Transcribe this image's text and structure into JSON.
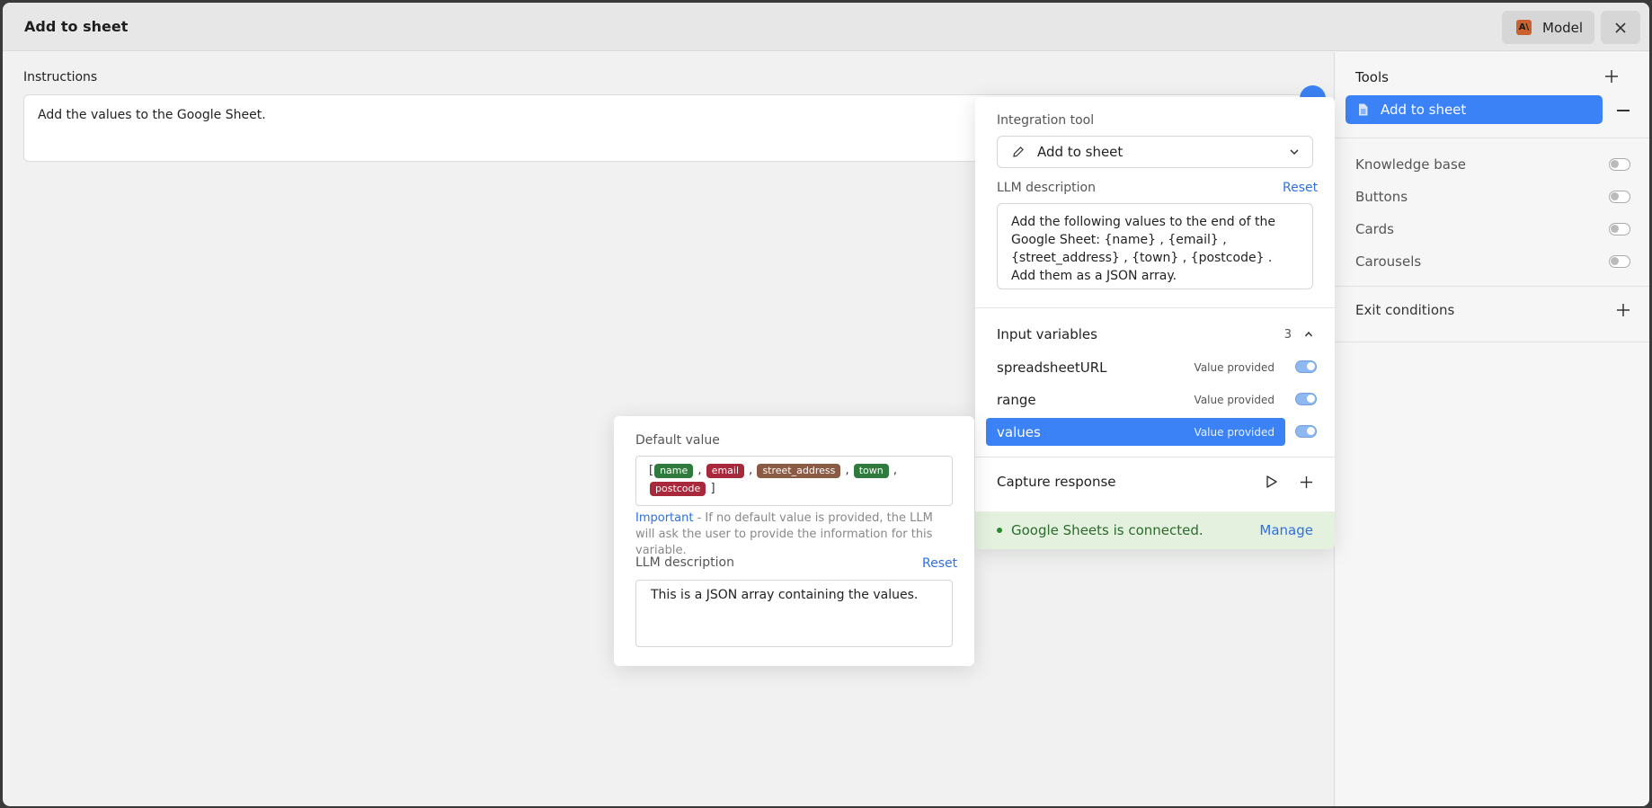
{
  "window": {
    "title": "Add to sheet",
    "model_label": "Model",
    "model_icon": "anthropic-icon"
  },
  "instructions": {
    "label": "Instructions",
    "text": "Add the values to the Google Sheet."
  },
  "sidebar": {
    "tools_header": "Tools",
    "active_tool": "Add to sheet",
    "toggles": [
      {
        "label": "Knowledge base",
        "on": false
      },
      {
        "label": "Buttons",
        "on": false
      },
      {
        "label": "Cards",
        "on": false
      },
      {
        "label": "Carousels",
        "on": false
      }
    ],
    "exit_conditions": "Exit conditions"
  },
  "tool_panel": {
    "integration_label": "Integration tool",
    "integration_value": "Add to sheet",
    "llm_label": "LLM description",
    "reset": "Reset",
    "llm_text": "Add the following values to the end of the Google Sheet: {name} , {email} , {street_address} , {town} , {postcode} . Add them as a JSON array.",
    "input_vars_label": "Input variables",
    "input_vars_count": "3",
    "vars": [
      {
        "name": "spreadsheetURL",
        "status": "Value provided",
        "on": true
      },
      {
        "name": "range",
        "status": "Value provided",
        "on": true
      },
      {
        "name": "values",
        "status": "Value provided",
        "on": true,
        "selected": true
      }
    ],
    "capture_label": "Capture response",
    "connected_text": "Google Sheets is connected.",
    "manage": "Manage"
  },
  "var_panel": {
    "default_label": "Default value",
    "open_bracket": "[",
    "close_bracket": "]",
    "chips": [
      {
        "text": "name",
        "color": "#2f7a3c"
      },
      {
        "text": "email",
        "color": "#a8283c"
      },
      {
        "text": "street_address",
        "color": "#8a5a44"
      },
      {
        "text": "town",
        "color": "#2f7a3c"
      },
      {
        "text": "postcode",
        "color": "#a8283c"
      }
    ],
    "important_label": "Important",
    "important_text": " - If no default value is provided, the LLM will ask the user to provide the information for this variable.",
    "llm_label": "LLM description",
    "reset": "Reset",
    "llm_text": "This is a JSON array containing the values."
  },
  "colors": {
    "accent": "#3b82f6",
    "link": "#2f6fe0",
    "connected_bg": "#e3f1de"
  }
}
